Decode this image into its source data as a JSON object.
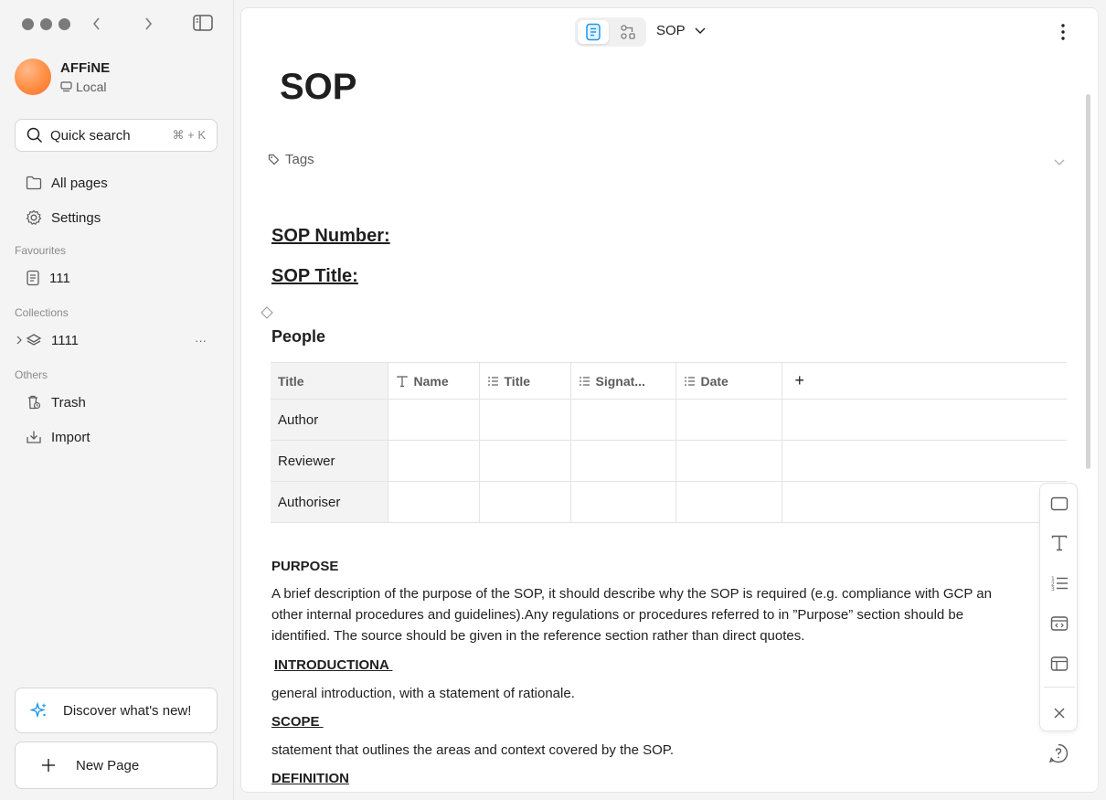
{
  "workspace": {
    "name": "AFFiNE",
    "storage": "Local"
  },
  "search": {
    "label": "Quick search",
    "shortcut": "⌘ + K"
  },
  "nav": {
    "all_pages": "All pages",
    "settings": "Settings"
  },
  "favourites": {
    "label": "Favourites",
    "items": [
      {
        "label": "111"
      }
    ]
  },
  "collections": {
    "label": "Collections",
    "items": [
      {
        "label": "1111",
        "more": "···"
      }
    ]
  },
  "others": {
    "label": "Others",
    "trash": "Trash",
    "import": "Import"
  },
  "footer": {
    "discover": "Discover what's new!",
    "new_page": "New Page"
  },
  "header": {
    "doc_title": "SOP"
  },
  "doc": {
    "title": "SOP",
    "tags_label": "Tags",
    "sop_number": "SOP Number:",
    "sop_title": "SOP Title:",
    "people_title": "People",
    "table": {
      "columns": [
        "Title",
        "Name",
        "Title",
        "Signat...",
        "Date"
      ],
      "add": "+",
      "rows": [
        {
          "title": "Author"
        },
        {
          "title": "Reviewer"
        },
        {
          "title": "Authoriser"
        }
      ]
    },
    "purpose_heading": "PURPOSE",
    "purpose_lines": [
      "A brief description of the purpose of the SOP, it should describe why the SOP is required (e.g. compliance with GCP an",
      "other internal procedures and guidelines).Any regulations or procedures referred to in ”Purpose” section should be",
      "identified. The source should be given in the reference section rather than direct quotes."
    ],
    "intro_heading": "INTRODUCTIONA ",
    "intro_text": "general introduction, with a statement of rationale.",
    "scope_heading": "SCOPE ",
    "scope_text": "statement that outlines the areas and context covered by the SOP.",
    "definition_heading": "DEFINITION"
  },
  "colors": {
    "accent": "#1e96eb",
    "sidebar_bg": "#f4f4f5"
  }
}
